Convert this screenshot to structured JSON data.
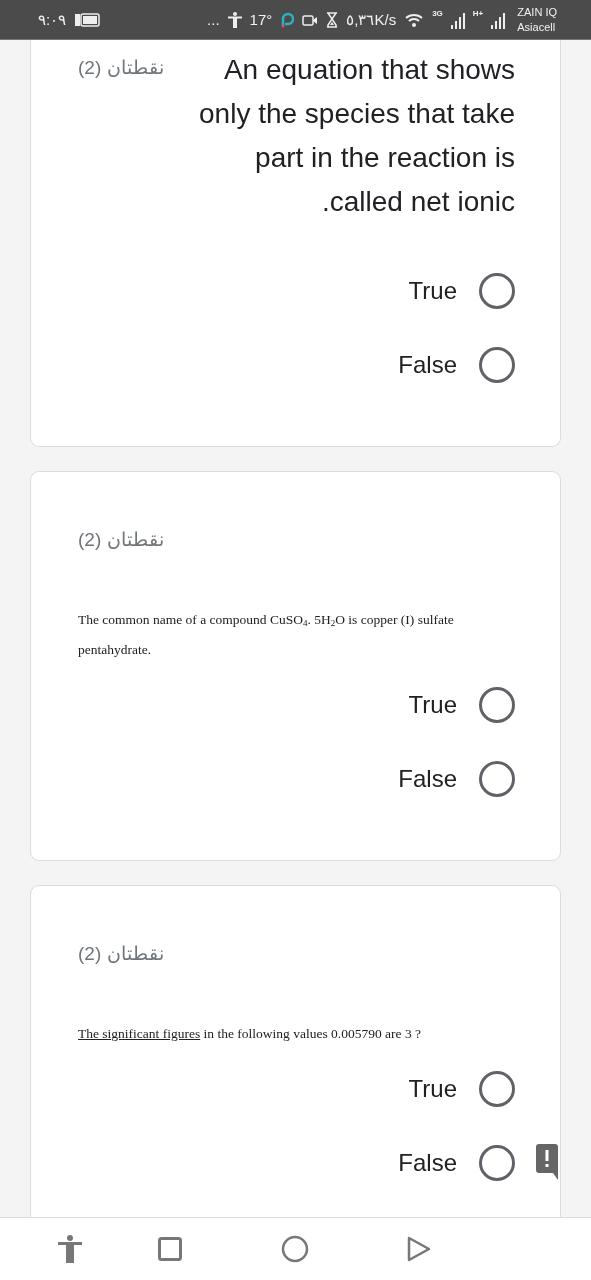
{
  "status_bar": {
    "time": "٩:٠٩",
    "more": "...",
    "temperature": "17°",
    "speed": "٥,٣٦K/s",
    "network_1": "3G",
    "network_2": "H+",
    "carrier_1": "ZAIN IQ",
    "carrier_2": "Asiacell"
  },
  "questions": [
    {
      "kind": "large",
      "points": "نقطتان (2)",
      "text": "An equation that shows only the species that take part in the reaction is called net ionic.",
      "options": [
        {
          "label": "True",
          "selected": false
        },
        {
          "label": "False",
          "selected": false
        }
      ]
    },
    {
      "kind": "serif",
      "points": "نقطتان (2)",
      "text": "The common name of a compound  CuSO$_{4}$. 5H$_{2}$O is copper (I) sulfate pentahydrate.",
      "options": [
        {
          "label": "True",
          "selected": false
        },
        {
          "label": "False",
          "selected": false
        }
      ]
    },
    {
      "kind": "serif",
      "points": "نقطتان (2)",
      "underlined": "The significant figures",
      "text": " in the following values  0.005790 are 3 ?",
      "feedback": true,
      "options": [
        {
          "label": "True",
          "selected": false
        },
        {
          "label": "False",
          "selected": false
        }
      ]
    }
  ]
}
